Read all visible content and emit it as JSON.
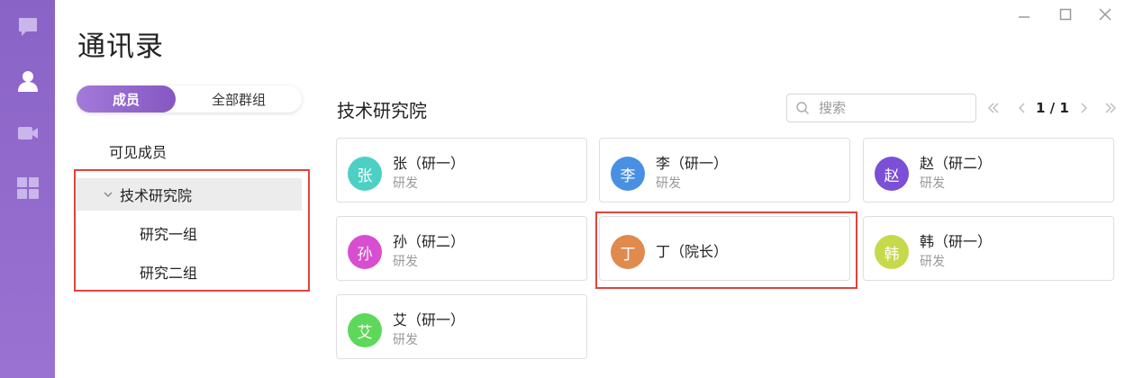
{
  "window": {
    "title": "通讯录",
    "controls": [
      "minimize-icon",
      "maximize-icon",
      "close-icon"
    ]
  },
  "sidebar": {
    "items": [
      {
        "icon": "chat-icon"
      },
      {
        "icon": "contacts-icon",
        "active": true
      },
      {
        "icon": "video-icon"
      },
      {
        "icon": "apps-grid-icon"
      }
    ]
  },
  "tabs": {
    "members": "成员",
    "all_groups": "全部群组",
    "active": "members"
  },
  "tree": {
    "visible_label": "可见成员",
    "root": "技术研究院",
    "children": [
      "研究一组",
      "研究二组"
    ]
  },
  "main": {
    "title": "技术研究院",
    "search_placeholder": "搜索",
    "pager": "1 / 1"
  },
  "contacts": [
    {
      "avatar_text": "张",
      "name": "张（研一）",
      "dept": "研发",
      "color": "#4dd0c4"
    },
    {
      "avatar_text": "李",
      "name": "李（研一）",
      "dept": "研发",
      "color": "#4a90e2"
    },
    {
      "avatar_text": "赵",
      "name": "赵（研二）",
      "dept": "研发",
      "color": "#7b4fd6"
    },
    {
      "avatar_text": "孙",
      "name": "孙（研二）",
      "dept": "研发",
      "color": "#d84ed0"
    },
    {
      "avatar_text": "丁",
      "name": "丁（院长）",
      "dept": "",
      "color": "#e08a4e"
    },
    {
      "avatar_text": "韩",
      "name": "韩（研一）",
      "dept": "研发",
      "color": "#c6d94a"
    },
    {
      "avatar_text": "艾",
      "name": "艾（研一）",
      "dept": "研发",
      "color": "#5ed85a"
    }
  ],
  "colors": {
    "accent": "#8a63c7",
    "highlight_border": "#e0443c"
  }
}
